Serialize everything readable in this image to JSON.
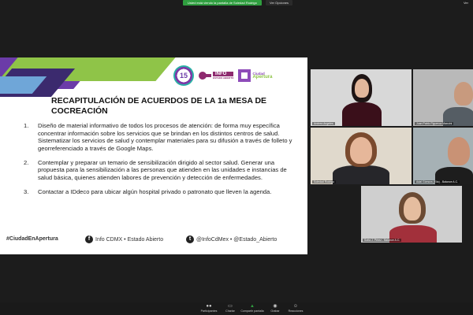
{
  "meeting": {
    "share_banner": "Usted está viendo la pantalla de Soledad Rodrigo",
    "stop_label": "Ver Opciones",
    "view_label": "Ver"
  },
  "slide": {
    "logos": {
      "logo15_text": "15",
      "key_big": "INFO",
      "key_small": "ESTADO ABIERTO",
      "city_line1": "Ciudad",
      "city_line2": "Apertura"
    },
    "title": "RECAPITULACIÓN DE ACUERDOS DE LA 1a MESA DE COCREACIÓN",
    "items": [
      {
        "num": "1.",
        "text": "Diseño de material informativo de todos los procesos de atención: de forma muy específica concentrar información sobre los servicios que se brindan en los distintos centros de salud. Sistematizar los servicios de salud y contemplar materiales para su difusión a través de folleto y georreferenciado a través de Google Maps."
      },
      {
        "num": "2.",
        "text": "Contemplar y preparar un temario de sensibilización dirigido al sector salud. Generar una propuesta para la sensibilización a las personas que atienden en las  unidades e instancias de salud básica, quienes atienden labores de prevención y detección de enfermedades."
      },
      {
        "num": "3.",
        "text": "Contactar a IDdeco para ubicar algún hospital privado o patronato que lleven la agenda."
      }
    ],
    "footer": {
      "hashtag": "#CiudadEnApertura",
      "facebook": "Info CDMX • Estado Abierto",
      "twitter": "@InfoCdMex • @Estado_Abierto"
    }
  },
  "participants": [
    {
      "name": "Andrea Angeles"
    },
    {
      "name": "Juan Pablo Figueroa Mancini"
    },
    {
      "name": "Soledad Rodrigo"
    },
    {
      "name": "Adal Gómora (Ella) - Balance A.C."
    },
    {
      "name": "Sofía J. Pérez - Balance A.C."
    }
  ],
  "toolbar": [
    {
      "label": "Participantes",
      "icon": "participants-icon"
    },
    {
      "label": "Charlar",
      "icon": "chat-icon"
    },
    {
      "label": "Compartir pantalla",
      "icon": "share-screen-icon"
    },
    {
      "label": "Grabar",
      "icon": "record-icon"
    },
    {
      "label": "Reacciones",
      "icon": "reactions-icon"
    }
  ],
  "colors": {
    "share_green": "#2f9e3f",
    "purple": "#6b3ba8",
    "lime": "#8fc448"
  }
}
